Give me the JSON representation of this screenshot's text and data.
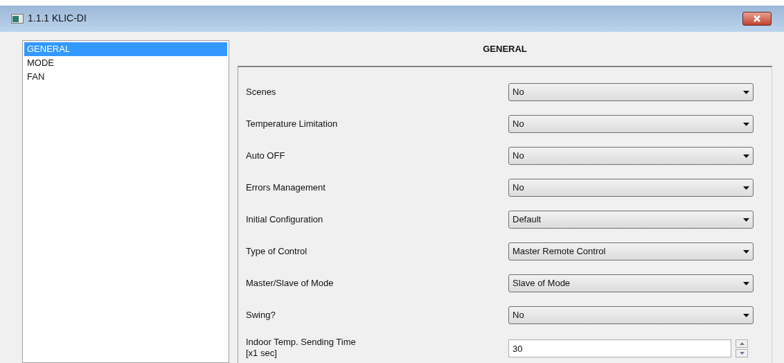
{
  "window": {
    "title": "1.1.1 KLIC-DI"
  },
  "sidebar": {
    "items": [
      {
        "label": "GENERAL",
        "selected": true
      },
      {
        "label": "MODE",
        "selected": false
      },
      {
        "label": "FAN",
        "selected": false
      }
    ]
  },
  "heading": "GENERAL",
  "params": [
    {
      "kind": "select",
      "label": "Scenes",
      "value": "No"
    },
    {
      "kind": "select",
      "label": "Temperature Limitation",
      "value": "No"
    },
    {
      "kind": "select",
      "label": "Auto OFF",
      "value": "No"
    },
    {
      "kind": "select",
      "label": "Errors Management",
      "value": "No"
    },
    {
      "kind": "select",
      "label": "Initial Configuration",
      "value": "Default"
    },
    {
      "kind": "select",
      "label": "Type of Control",
      "value": "Master Remote Control"
    },
    {
      "kind": "select",
      "label": "Master/Slave of Mode",
      "value": "Slave of Mode"
    },
    {
      "kind": "select",
      "label": "Swing?",
      "value": "No"
    },
    {
      "kind": "spin",
      "label": "Indoor Temp. Sending Time",
      "sublabel": "[x1 sec]",
      "value": "30"
    }
  ]
}
